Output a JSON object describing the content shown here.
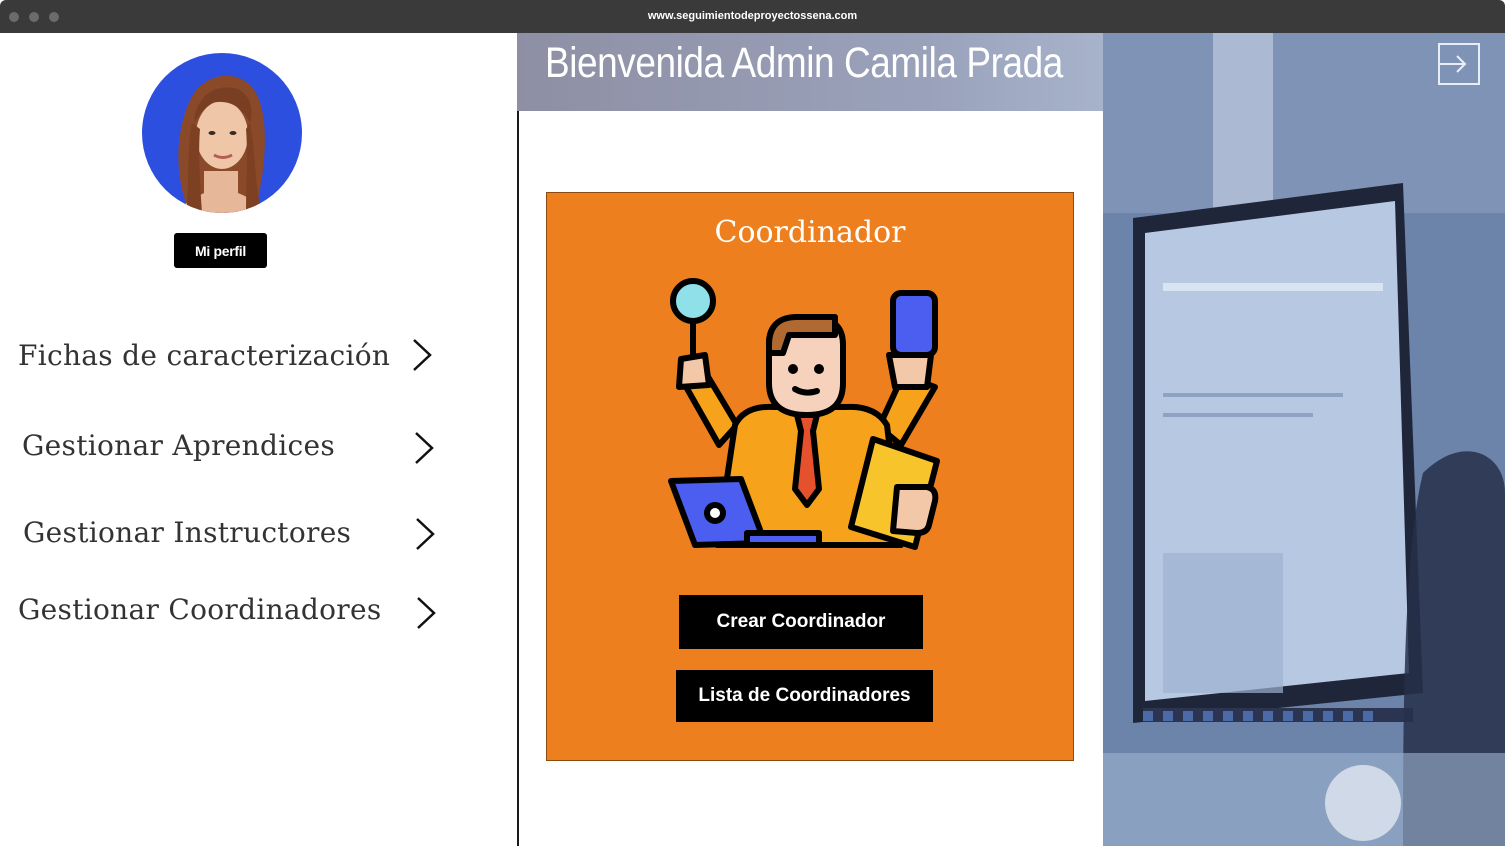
{
  "browser": {
    "url": "www.seguimientodeproyectossena.com"
  },
  "sidebar": {
    "profile_button": "Mi perfil",
    "items": [
      {
        "label": "Fichas de caracterización"
      },
      {
        "label": "Gestionar Aprendices"
      },
      {
        "label": "Gestionar Instructores"
      },
      {
        "label": "Gestionar Coordinadores"
      }
    ]
  },
  "header": {
    "title": "Bienvenida Admin Camila Prada"
  },
  "card": {
    "title": "Coordinador",
    "create_button": "Crear Coordinador",
    "list_button": "Lista de Coordinadores"
  },
  "colors": {
    "card": "#ee7f1e",
    "avatar_bg": "#2c4fe0",
    "button": "#000000"
  },
  "icons": [
    "user-avatar",
    "chevron-right-icon",
    "logout-icon",
    "coordinator-illustration"
  ]
}
